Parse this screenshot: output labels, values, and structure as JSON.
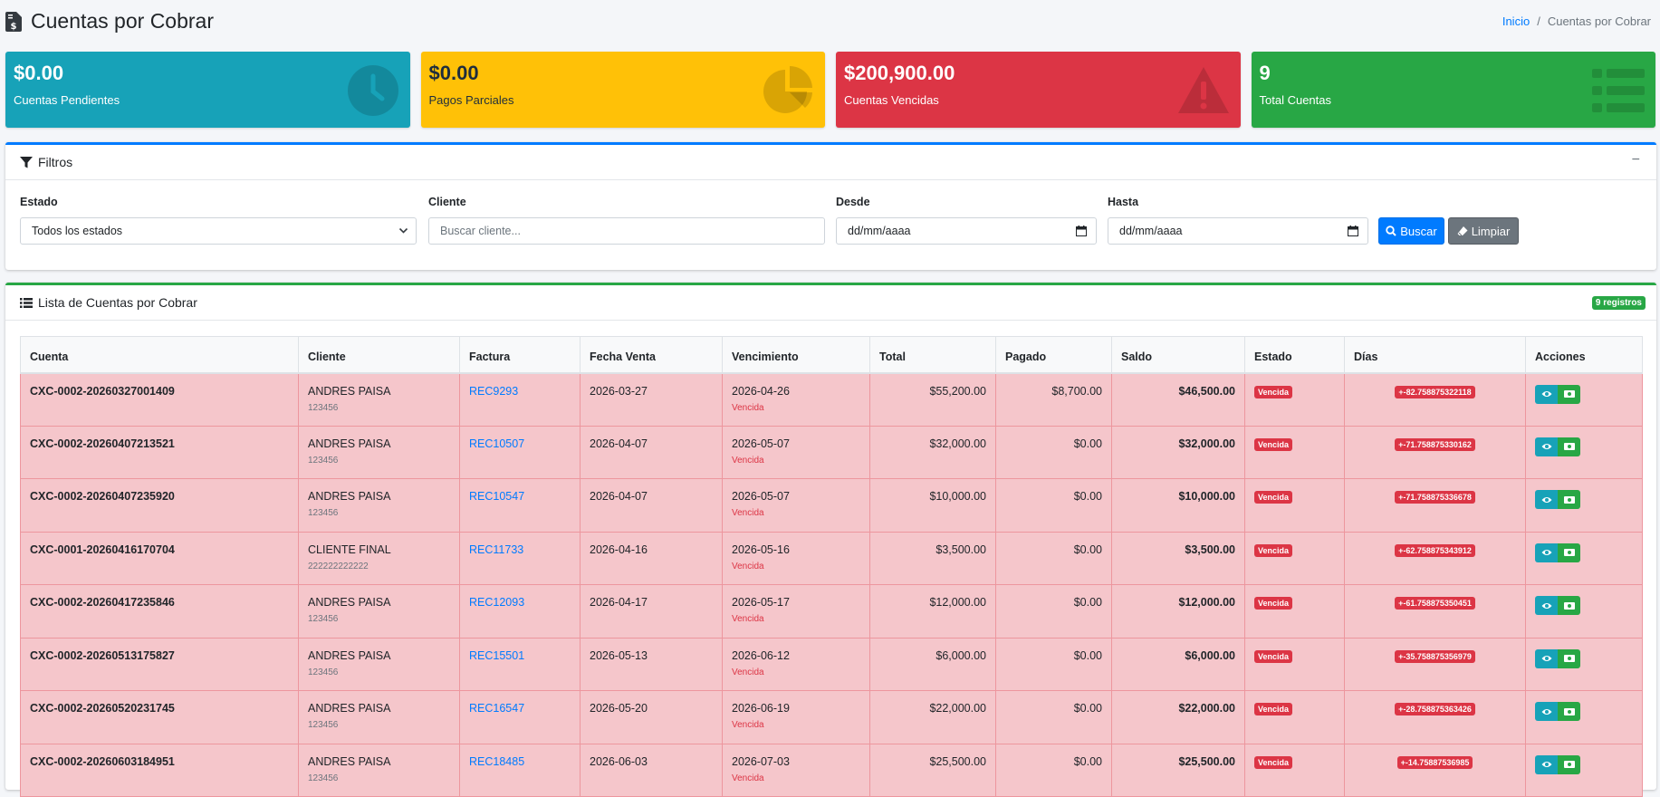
{
  "header": {
    "title": "Cuentas por Cobrar",
    "breadcrumb": {
      "home": "Inicio",
      "separator": "/",
      "current": "Cuentas por Cobrar"
    }
  },
  "stats": [
    {
      "value": "$0.00",
      "label": "Cuentas Pendientes",
      "icon": "clock-icon",
      "color": "#17a2b8"
    },
    {
      "value": "$0.00",
      "label": "Pagos Parciales",
      "icon": "pie-chart-icon",
      "color": "#ffc107"
    },
    {
      "value": "$200,900.00",
      "label": "Cuentas Vencidas",
      "icon": "warning-icon",
      "color": "#dc3545"
    },
    {
      "value": "9",
      "label": "Total Cuentas",
      "icon": "list-icon",
      "color": "#28a745"
    }
  ],
  "filters": {
    "title": "Filtros",
    "collapse": "−",
    "estado_label": "Estado",
    "estado_value": "Todos los estados",
    "cliente_label": "Cliente",
    "cliente_placeholder": "Buscar cliente...",
    "desde_label": "Desde",
    "desde_placeholder": "dd/mm/aaaa",
    "hasta_label": "Hasta",
    "hasta_placeholder": "dd/mm/aaaa",
    "buscar": "Buscar",
    "limpiar": "Limpiar"
  },
  "list": {
    "title": "Lista de Cuentas por Cobrar",
    "count": "9 registros",
    "columns": [
      "Cuenta",
      "Cliente",
      "Factura",
      "Fecha Venta",
      "Vencimiento",
      "Total",
      "Pagado",
      "Saldo",
      "Estado",
      "Días",
      "Acciones"
    ],
    "rows": [
      {
        "cuenta": "CXC-0002-20260327001409",
        "cliente": "ANDRES PAISA",
        "doc": "123456",
        "factura": "REC9293",
        "fecha": "2026-03-27",
        "venc": "2026-04-26",
        "venc_status": "Vencida",
        "total": "$55,200.00",
        "pagado": "$8,700.00",
        "saldo": "$46,500.00",
        "estado": "Vencida",
        "dias": "+-82.758875322118"
      },
      {
        "cuenta": "CXC-0002-20260407213521",
        "cliente": "ANDRES PAISA",
        "doc": "123456",
        "factura": "REC10507",
        "fecha": "2026-04-07",
        "venc": "2026-05-07",
        "venc_status": "Vencida",
        "total": "$32,000.00",
        "pagado": "$0.00",
        "saldo": "$32,000.00",
        "estado": "Vencida",
        "dias": "+-71.758875330162"
      },
      {
        "cuenta": "CXC-0002-20260407235920",
        "cliente": "ANDRES PAISA",
        "doc": "123456",
        "factura": "REC10547",
        "fecha": "2026-04-07",
        "venc": "2026-05-07",
        "venc_status": "Vencida",
        "total": "$10,000.00",
        "pagado": "$0.00",
        "saldo": "$10,000.00",
        "estado": "Vencida",
        "dias": "+-71.758875336678"
      },
      {
        "cuenta": "CXC-0001-20260416170704",
        "cliente": "CLIENTE FINAL",
        "doc": "222222222222",
        "factura": "REC11733",
        "fecha": "2026-04-16",
        "venc": "2026-05-16",
        "venc_status": "Vencida",
        "total": "$3,500.00",
        "pagado": "$0.00",
        "saldo": "$3,500.00",
        "estado": "Vencida",
        "dias": "+-62.758875343912"
      },
      {
        "cuenta": "CXC-0002-20260417235846",
        "cliente": "ANDRES PAISA",
        "doc": "123456",
        "factura": "REC12093",
        "fecha": "2026-04-17",
        "venc": "2026-05-17",
        "venc_status": "Vencida",
        "total": "$12,000.00",
        "pagado": "$0.00",
        "saldo": "$12,000.00",
        "estado": "Vencida",
        "dias": "+-61.758875350451"
      },
      {
        "cuenta": "CXC-0002-20260513175827",
        "cliente": "ANDRES PAISA",
        "doc": "123456",
        "factura": "REC15501",
        "fecha": "2026-05-13",
        "venc": "2026-06-12",
        "venc_status": "Vencida",
        "total": "$6,000.00",
        "pagado": "$0.00",
        "saldo": "$6,000.00",
        "estado": "Vencida",
        "dias": "+-35.758875356979"
      },
      {
        "cuenta": "CXC-0002-20260520231745",
        "cliente": "ANDRES PAISA",
        "doc": "123456",
        "factura": "REC16547",
        "fecha": "2026-05-20",
        "venc": "2026-06-19",
        "venc_status": "Vencida",
        "total": "$22,000.00",
        "pagado": "$0.00",
        "saldo": "$22,000.00",
        "estado": "Vencida",
        "dias": "+-28.758875363426"
      },
      {
        "cuenta": "CXC-0002-20260603184951",
        "cliente": "ANDRES PAISA",
        "doc": "123456",
        "factura": "REC18485",
        "fecha": "2026-06-03",
        "venc": "2026-07-03",
        "venc_status": "Vencida",
        "total": "$25,500.00",
        "pagado": "$0.00",
        "saldo": "$25,500.00",
        "estado": "Vencida",
        "dias": "+-14.75887536985"
      }
    ]
  }
}
